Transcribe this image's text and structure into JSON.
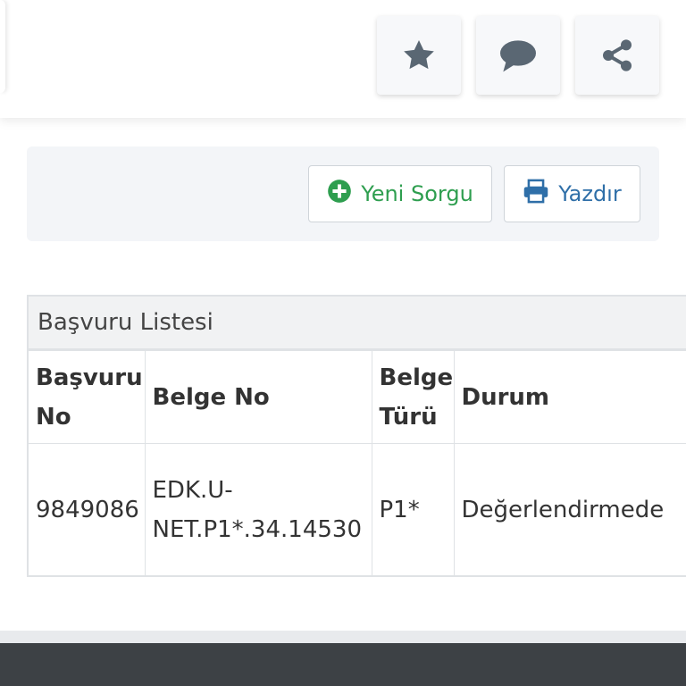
{
  "header": {
    "actions": [
      {
        "name": "favorite",
        "icon": "star-icon"
      },
      {
        "name": "comment",
        "icon": "comment-icon"
      },
      {
        "name": "share",
        "icon": "share-icon"
      }
    ]
  },
  "toolbar": {
    "new_query_label": "Yeni Sorgu",
    "new_query_icon": "plus-circle-icon",
    "print_label": "Yazdır",
    "print_icon": "printer-icon"
  },
  "list": {
    "title": "Başvuru Listesi",
    "columns": [
      "Başvuru No",
      "Belge No",
      "Belge Türü",
      "Durum"
    ],
    "rows": [
      {
        "basvuru_no": "9849086",
        "belge_no": "EDK.U-NET.P1*.34.14530",
        "belge_turu": "P1*",
        "durum": "Değerlendirmede"
      }
    ]
  },
  "colors": {
    "accent_green": "#2e9e4f",
    "accent_blue": "#2f6fa8",
    "icon_gray": "#5a6773",
    "footer": "#3d4145"
  }
}
